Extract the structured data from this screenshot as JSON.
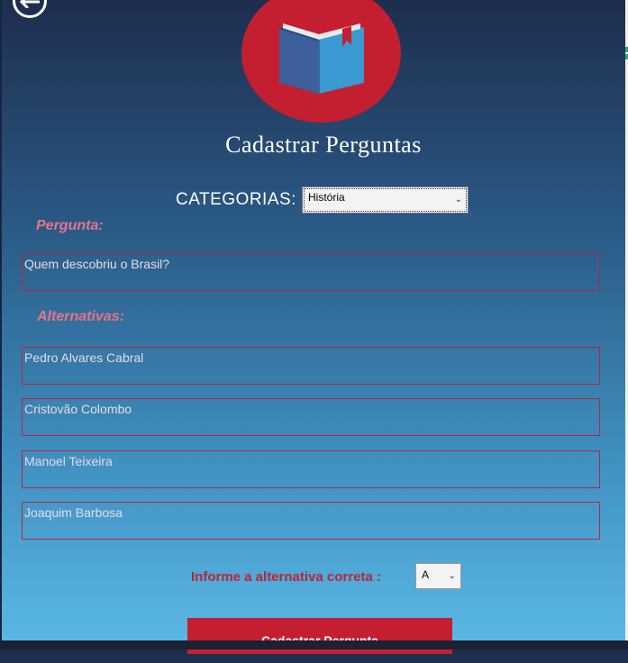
{
  "colors": {
    "accent_red": "#c41f30",
    "label_pink": "#e8738a",
    "field_border": "#b5283a",
    "field_text": "#e9d9e4",
    "bg_top": "#1e2d4e",
    "bg_bottom": "#5bb9e6"
  },
  "icons": {
    "back": "back-arrow-icon",
    "logo": "book-icon"
  },
  "title": "Cadastrar Perguntas",
  "category": {
    "label": "CATEGORIAS:",
    "selected": "História"
  },
  "question": {
    "label": "Pergunta:",
    "value": "Quem descobriu o Brasil?"
  },
  "alternatives": {
    "label": "Alternativas:",
    "items": [
      "Pedro Alvares Cabral",
      "Cristovão Colombo",
      "Manoel Teixeira",
      "Joaquim Barbosa"
    ]
  },
  "correct": {
    "label": "Informe a alternativa correta :",
    "selected": "A"
  },
  "submit_label": "Cadastrar Pergunta"
}
